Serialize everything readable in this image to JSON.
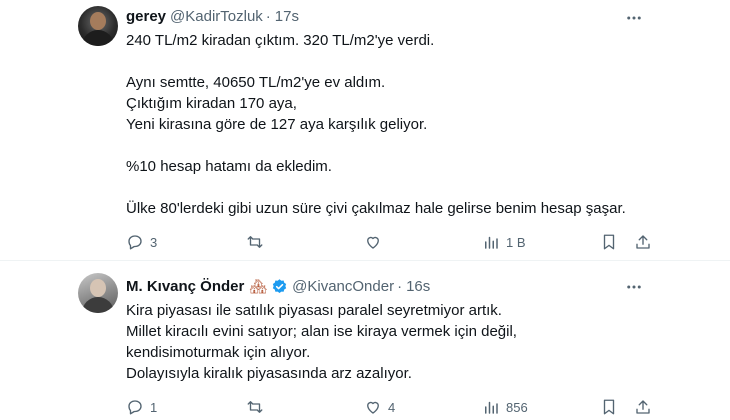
{
  "tweets": [
    {
      "name": "gerey",
      "handle": "@KadirTozluk",
      "separator": "·",
      "time": "17s",
      "lines": [
        "240 TL/m2 kiradan çıktım. 320 TL/m2'ye verdi.",
        "",
        "Aynı semtte, 40650 TL/m2'ye ev aldım.",
        "Çıktığım kiradan 170 aya,",
        "Yeni kirasına göre de 127 aya karşılık geliyor.",
        "",
        "%10 hesap hatamı da ekledim.",
        "",
        "Ülke 80'lerdeki gibi uzun süre çivi çakılmaz hale gelirse benim hesap şaşar."
      ],
      "replies": "3",
      "retweets": "",
      "likes": "",
      "views": "1 B"
    },
    {
      "name": "M. Kıvanç Önder",
      "name_emoji": "🏘",
      "handle": "@KivancOnder",
      "separator": "·",
      "time": "16s",
      "lines": [
        "Kira piyasası ile satılık piyasası paralel seyretmiyor artık.",
        "Millet kiracılı evini satıyor; alan ise kiraya vermek için değil,",
        "kendisimoturmak için alıyor.",
        "Dolayısıyla kiralık piyasasında arz azalıyor."
      ],
      "replies": "1",
      "retweets": "",
      "likes": "4",
      "views": "856"
    }
  ],
  "colors": {
    "text": "#0f1419",
    "secondary": "#536471",
    "verified": "#1d9bf0",
    "divider": "#eff3f4"
  },
  "icons": [
    "more-icon",
    "reply-icon",
    "retweet-icon",
    "like-icon",
    "views-icon",
    "bookmark-icon",
    "share-icon",
    "verified-icon"
  ]
}
